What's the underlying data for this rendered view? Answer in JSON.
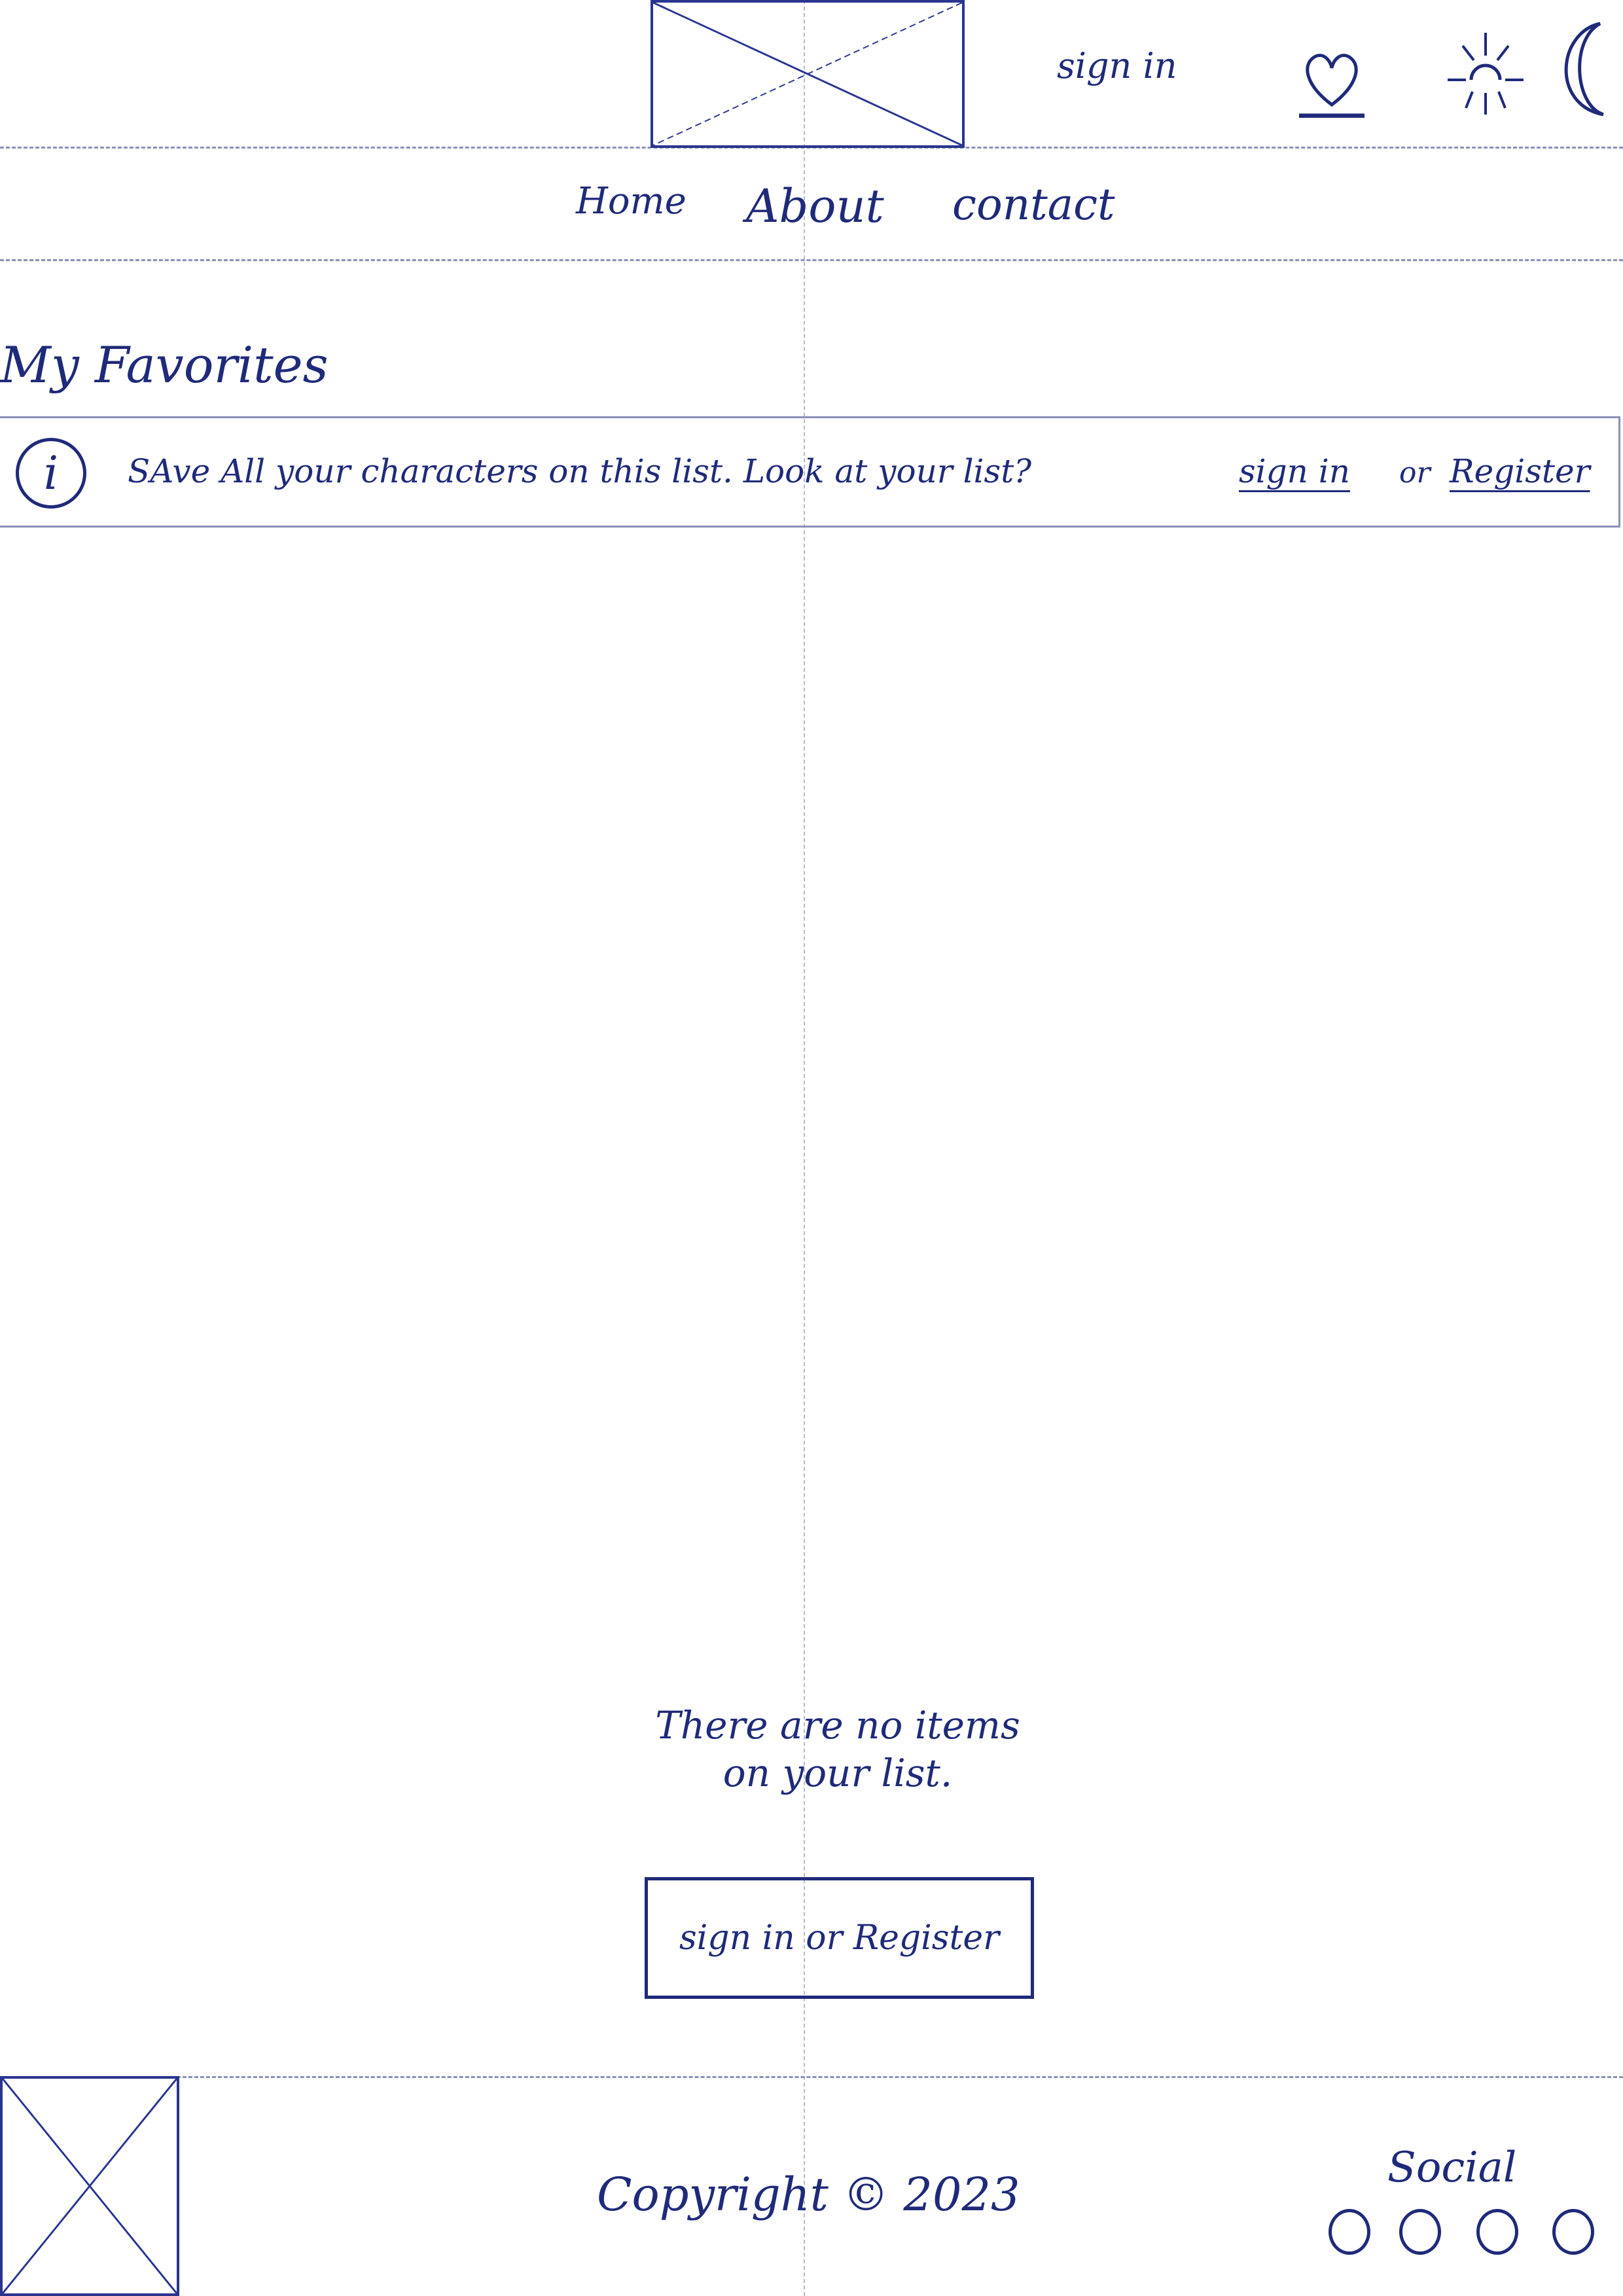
{
  "header": {
    "logo_icon": "logo-placeholder-icon",
    "sign_in_label": "sign in",
    "favorites_icon": "heart-icon",
    "light_mode_icon": "sun-icon",
    "dark_mode_icon": "moon-icon"
  },
  "nav": {
    "items": [
      {
        "label": "Home"
      },
      {
        "label": "About"
      },
      {
        "label": "contact"
      }
    ]
  },
  "page": {
    "title": "My Favorites"
  },
  "notice": {
    "info_icon": "i",
    "message": "SAve All your characters on this list. Look at your list?",
    "sign_in_link": "sign in",
    "or_text": "or",
    "register_link": "Register"
  },
  "empty_state": {
    "line1": "There are no items",
    "line2": "on your list.",
    "button_label": "sign in or Register"
  },
  "footer": {
    "logo_icon": "logo-placeholder-icon",
    "copyright": "Copyright © 2023",
    "social_label": "Social",
    "social_icons": [
      "social-icon-1",
      "social-icon-2",
      "social-icon-3",
      "social-icon-4"
    ]
  },
  "colors": {
    "ink": "#1f2a7a",
    "guide_line": "#8a90b8"
  }
}
